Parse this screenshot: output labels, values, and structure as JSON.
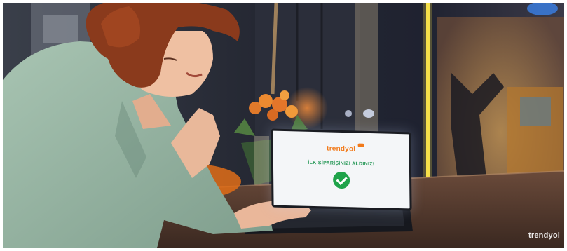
{
  "laptop_screen": {
    "brand": "trendyol",
    "message": "İLK SİPARİŞİNİZİ ALDINIZ!"
  },
  "watermark": "trendyol"
}
